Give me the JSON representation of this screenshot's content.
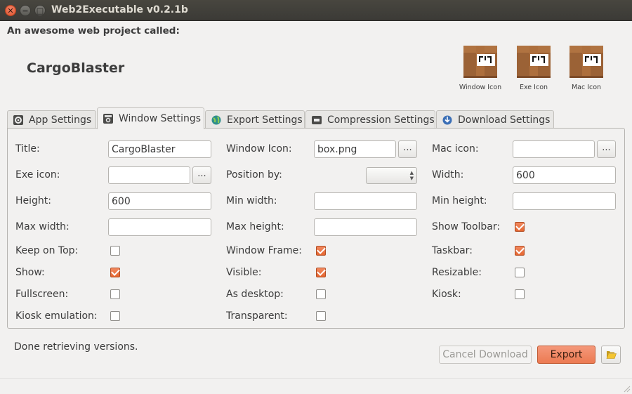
{
  "window": {
    "title": "Web2Executable v0.2.1b"
  },
  "header": {
    "intro": "An awesome web project called:",
    "project_name": "CargoBlaster",
    "icons": [
      {
        "caption": "Window Icon",
        "icon": "cardboard-box-icon"
      },
      {
        "caption": "Exe Icon",
        "icon": "cardboard-box-icon"
      },
      {
        "caption": "Mac Icon",
        "icon": "cardboard-box-icon"
      }
    ]
  },
  "tabs": [
    {
      "label": "App Settings",
      "icon": "gear-icon",
      "active": false
    },
    {
      "label": "Window Settings",
      "icon": "window-gear-icon",
      "active": true
    },
    {
      "label": "Export Settings",
      "icon": "globe-icon",
      "active": false
    },
    {
      "label": "Compression Settings",
      "icon": "compress-icon",
      "active": false
    },
    {
      "label": "Download Settings",
      "icon": "download-icon",
      "active": false
    }
  ],
  "form": {
    "title": {
      "label": "Title:",
      "value": "CargoBlaster"
    },
    "window_icon": {
      "label": "Window Icon:",
      "value": "box.png",
      "browse": "..."
    },
    "mac_icon": {
      "label": "Mac icon:",
      "value": "",
      "browse": "..."
    },
    "exe_icon": {
      "label": "Exe icon:",
      "value": "",
      "browse": "..."
    },
    "position_by": {
      "label": "Position by:",
      "value": ""
    },
    "width": {
      "label": "Width:",
      "value": "600"
    },
    "height": {
      "label": "Height:",
      "value": "600"
    },
    "min_width": {
      "label": "Min width:",
      "value": ""
    },
    "min_height": {
      "label": "Min height:",
      "value": ""
    },
    "max_width": {
      "label": "Max width:",
      "value": ""
    },
    "max_height": {
      "label": "Max height:",
      "value": ""
    },
    "show_toolbar": {
      "label": "Show Toolbar:",
      "checked": true
    },
    "keep_on_top": {
      "label": "Keep on Top:",
      "checked": false
    },
    "window_frame": {
      "label": "Window Frame:",
      "checked": true
    },
    "taskbar": {
      "label": "Taskbar:",
      "checked": true
    },
    "show": {
      "label": "Show:",
      "checked": true
    },
    "visible": {
      "label": "Visible:",
      "checked": true
    },
    "resizable": {
      "label": "Resizable:",
      "checked": false
    },
    "fullscreen": {
      "label": "Fullscreen:",
      "checked": false
    },
    "as_desktop": {
      "label": "As desktop:",
      "checked": false
    },
    "kiosk": {
      "label": "Kiosk:",
      "checked": false
    },
    "kiosk_emulation": {
      "label": "Kiosk emulation:",
      "checked": false
    },
    "transparent": {
      "label": "Transparent:",
      "checked": false
    }
  },
  "footer": {
    "status": "Done retrieving versions.",
    "cancel_label": "Cancel Download",
    "export_label": "Export",
    "open_folder_icon": "folder-open-icon"
  },
  "colors": {
    "accent": "#e5652f",
    "titlebar": "#3c3b37"
  }
}
